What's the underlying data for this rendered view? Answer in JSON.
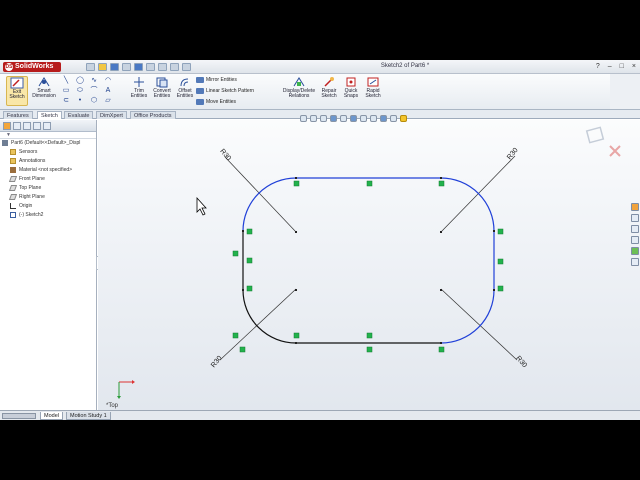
{
  "app": {
    "logo_text": "SolidWorks",
    "logo_mark": "DS",
    "document_title": "Sketch2 of Part6 *",
    "window_controls": [
      "?",
      "–",
      "□",
      "×"
    ]
  },
  "command_manager": {
    "exit_sketch": "Exit Sketch",
    "smart_dimension": "Smart Dimension",
    "trim_entities": "Trim Entities",
    "convert_entities": "Convert Entities",
    "offset_entities": "Offset Entities",
    "mirror_entities": "Mirror Entities",
    "linear_sketch_pattern": "Linear Sketch Pattern",
    "move_entities": "Move Entities",
    "display_delete_relations": "Display/Delete Relations",
    "repair_sketch": "Repair Sketch",
    "quick_snaps": "Quick Snaps",
    "rapid_sketch": "Rapid Sketch"
  },
  "tabs": [
    "Features",
    "Sketch",
    "Evaluate",
    "DimXpert",
    "Office Products"
  ],
  "active_tab": "Sketch",
  "feature_tree": {
    "root": "Part6 (Default<<Default>_Displ",
    "items": [
      "Sensors",
      "Annotations",
      "Material <not specified>",
      "Front Plane",
      "Top Plane",
      "Right Plane",
      "Origin",
      "(-) Sketch2"
    ]
  },
  "sketch": {
    "dimensions": [
      "R30",
      "R30",
      "R30",
      "R30"
    ],
    "view_label": "*Top"
  },
  "colors": {
    "selected_edge": "#2040d8",
    "unselected_edge": "#111111",
    "relation_glyph": "#22b24c",
    "brand": "#b71c1c"
  },
  "bottom_tabs": [
    "Model",
    "Motion Study 1"
  ],
  "active_bottom_tab": "Model"
}
